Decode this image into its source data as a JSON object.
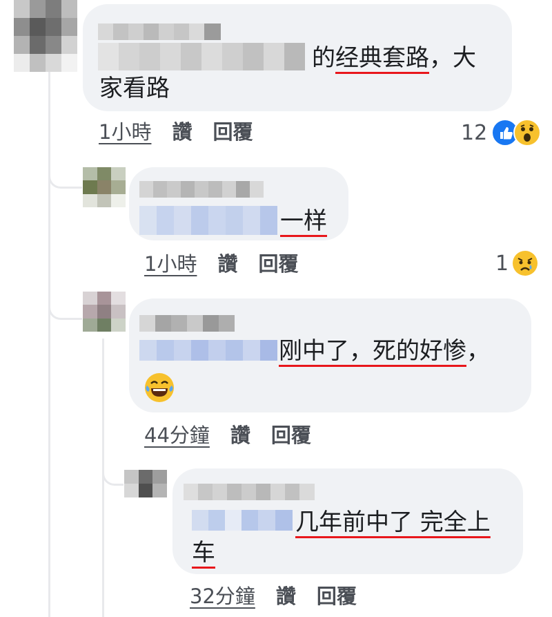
{
  "comments": [
    {
      "text_before_line": "的",
      "text_underlined": "经典套路",
      "text_after": "，大",
      "text_line2": "家看路",
      "time": "1小時",
      "like": "讚",
      "reply": "回覆",
      "reaction_count": "12",
      "reactions": [
        "like-icon",
        "wow-icon"
      ]
    },
    {
      "text_underlined": "一样",
      "time": "1小時",
      "like": "讚",
      "reply": "回覆",
      "reaction_count": "1",
      "reactions": [
        "sad-icon"
      ]
    },
    {
      "text_underlined": "刚中了，死的好惨",
      "text_after": "，",
      "emoji": "laugh-cry-icon",
      "time": "44分鐘",
      "like": "讚",
      "reply": "回覆"
    },
    {
      "text_underlined": "几年前中了 完全上",
      "text_line2_underlined": "车",
      "time": "32分鐘",
      "like": "讚",
      "reply": "回覆"
    }
  ],
  "colors": {
    "bubble": "#f0f2f5",
    "underline": "#e8161b",
    "like_blue": "#1877f2",
    "emoji_yellow": "#f7c12d",
    "meta_text": "#4b4f56"
  }
}
